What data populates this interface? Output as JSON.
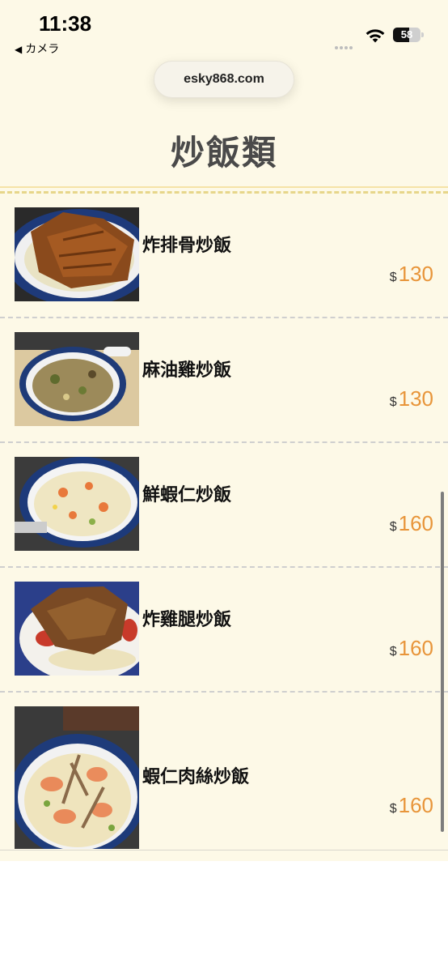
{
  "status_bar": {
    "time": "11:38",
    "back_app": "カメラ",
    "battery_level": "58"
  },
  "browser": {
    "url": "esky868.com"
  },
  "category": {
    "title": "炒飯類"
  },
  "items": [
    {
      "name": "炸排骨炒飯",
      "currency": "$",
      "price": "130",
      "image": "fried-pork-chop-rice-photo"
    },
    {
      "name": "麻油雞炒飯",
      "currency": "$",
      "price": "130",
      "image": "sesame-oil-chicken-rice-photo"
    },
    {
      "name": "鮮蝦仁炒飯",
      "currency": "$",
      "price": "160",
      "image": "shrimp-fried-rice-photo"
    },
    {
      "name": "炸雞腿炒飯",
      "currency": "$",
      "price": "160",
      "image": "fried-chicken-leg-rice-photo"
    },
    {
      "name": "蝦仁肉絲炒飯",
      "currency": "$",
      "price": "160",
      "image": "shrimp-pork-fried-rice-photo"
    }
  ],
  "colors": {
    "background": "#fdf9e7",
    "price": "#e8953a",
    "title": "#4a4a4a"
  }
}
